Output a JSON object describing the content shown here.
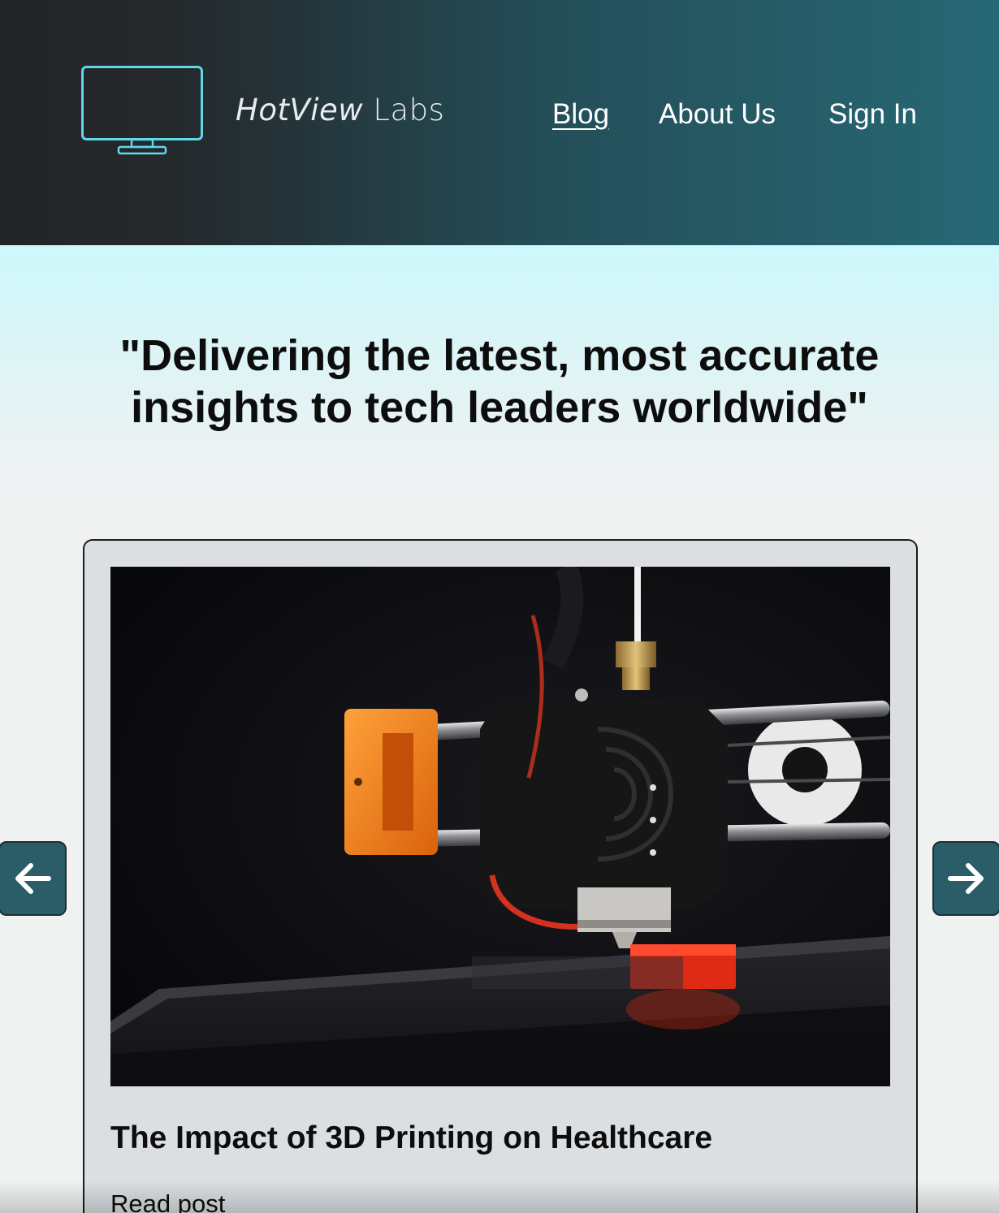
{
  "brand": {
    "name_part1": "HotView",
    "name_part2": "Labs",
    "logo_icon": "monitor-icon",
    "accent_color": "#5fd8e8"
  },
  "nav": {
    "items": [
      {
        "label": "Blog",
        "active": true
      },
      {
        "label": "About Us",
        "active": false
      },
      {
        "label": "Sign In",
        "active": false
      }
    ]
  },
  "hero": {
    "tagline": "\"Delivering the latest, most accurate insights to tech leaders worldwide\""
  },
  "carousel": {
    "prev_icon": "arrow-left-icon",
    "next_icon": "arrow-right-icon",
    "current_post": {
      "image": "3d-printer-photo",
      "title": "The Impact of 3D Printing on Healthcare",
      "link_label": "Read post"
    }
  },
  "colors": {
    "header_dark": "#232426",
    "header_teal": "#276875",
    "hero_top": "#ccf8fc",
    "card_bg": "#dcdfe2",
    "arrow_bg": "#2b5d68"
  }
}
